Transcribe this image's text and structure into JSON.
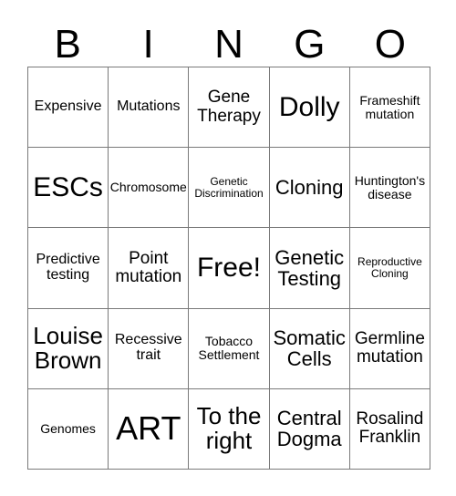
{
  "card": {
    "title": "BINGO",
    "header_letters": [
      "B",
      "I",
      "N",
      "G",
      "O"
    ],
    "columns": 5,
    "rows": 5,
    "border_color": "#7a7a7a",
    "background_color": "#ffffff",
    "text_color": "#000000",
    "free_space_label": "Free!",
    "free_space_position": {
      "row": 3,
      "column": 3
    },
    "cells": [
      [
        {
          "text": "Expensive",
          "size": "fs-m"
        },
        {
          "text": "Mutations",
          "size": "fs-m"
        },
        {
          "text": "Gene Therapy",
          "size": "fs-l"
        },
        {
          "text": "Dolly",
          "size": "fs-huge"
        },
        {
          "text": "Frameshift mutation",
          "size": "fs-s"
        }
      ],
      [
        {
          "text": "ESCs",
          "size": "fs-huge"
        },
        {
          "text": "Chromosome",
          "size": "fs-s"
        },
        {
          "text": "Genetic Discrimination",
          "size": "fs-xs"
        },
        {
          "text": "Cloning",
          "size": "fs-xl"
        },
        {
          "text": "Huntington's disease",
          "size": "fs-s"
        }
      ],
      [
        {
          "text": "Predictive testing",
          "size": "fs-m"
        },
        {
          "text": "Point mutation",
          "size": "fs-l"
        },
        {
          "text": "Free!",
          "size": "fs-huge"
        },
        {
          "text": "Genetic Testing",
          "size": "fs-xl"
        },
        {
          "text": "Reproductive Cloning",
          "size": "fs-xs"
        }
      ],
      [
        {
          "text": "Louise Brown",
          "size": "fs-xxl"
        },
        {
          "text": "Recessive trait",
          "size": "fs-m"
        },
        {
          "text": "Tobacco Settlement",
          "size": "fs-s"
        },
        {
          "text": "Somatic Cells",
          "size": "fs-xl"
        },
        {
          "text": "Germline mutation",
          "size": "fs-l"
        }
      ],
      [
        {
          "text": "Genomes",
          "size": "fs-s"
        },
        {
          "text": "ART",
          "size": "fs-mega"
        },
        {
          "text": "To the right",
          "size": "fs-xxl"
        },
        {
          "text": "Central Dogma",
          "size": "fs-xl"
        },
        {
          "text": "Rosalind Franklin",
          "size": "fs-l"
        }
      ]
    ]
  }
}
